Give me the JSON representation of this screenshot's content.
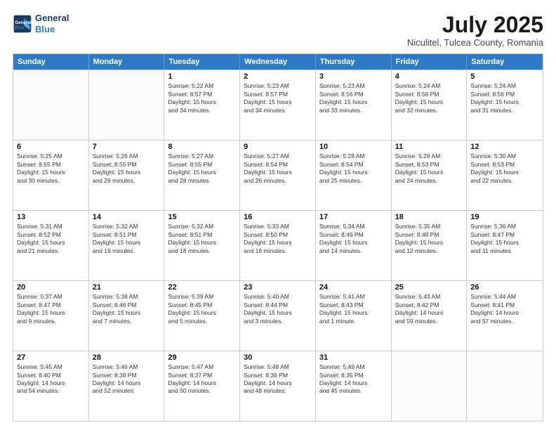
{
  "logo": {
    "line1": "General",
    "line2": "Blue"
  },
  "title": "July 2025",
  "subtitle": "Niculitel, Tulcea County, Romania",
  "header_days": [
    "Sunday",
    "Monday",
    "Tuesday",
    "Wednesday",
    "Thursday",
    "Friday",
    "Saturday"
  ],
  "weeks": [
    [
      {
        "day": "",
        "lines": []
      },
      {
        "day": "",
        "lines": []
      },
      {
        "day": "1",
        "lines": [
          "Sunrise: 5:22 AM",
          "Sunset: 8:57 PM",
          "Daylight: 15 hours",
          "and 34 minutes."
        ]
      },
      {
        "day": "2",
        "lines": [
          "Sunrise: 5:23 AM",
          "Sunset: 8:57 PM",
          "Daylight: 15 hours",
          "and 34 minutes."
        ]
      },
      {
        "day": "3",
        "lines": [
          "Sunrise: 5:23 AM",
          "Sunset: 8:56 PM",
          "Daylight: 15 hours",
          "and 33 minutes."
        ]
      },
      {
        "day": "4",
        "lines": [
          "Sunrise: 5:24 AM",
          "Sunset: 8:56 PM",
          "Daylight: 15 hours",
          "and 32 minutes."
        ]
      },
      {
        "day": "5",
        "lines": [
          "Sunrise: 5:24 AM",
          "Sunset: 8:56 PM",
          "Daylight: 15 hours",
          "and 31 minutes."
        ]
      }
    ],
    [
      {
        "day": "6",
        "lines": [
          "Sunrise: 5:25 AM",
          "Sunset: 8:55 PM",
          "Daylight: 15 hours",
          "and 30 minutes."
        ]
      },
      {
        "day": "7",
        "lines": [
          "Sunrise: 5:26 AM",
          "Sunset: 8:55 PM",
          "Daylight: 15 hours",
          "and 29 minutes."
        ]
      },
      {
        "day": "8",
        "lines": [
          "Sunrise: 5:27 AM",
          "Sunset: 8:55 PM",
          "Daylight: 15 hours",
          "and 28 minutes."
        ]
      },
      {
        "day": "9",
        "lines": [
          "Sunrise: 5:27 AM",
          "Sunset: 8:54 PM",
          "Daylight: 15 hours",
          "and 26 minutes."
        ]
      },
      {
        "day": "10",
        "lines": [
          "Sunrise: 5:28 AM",
          "Sunset: 8:54 PM",
          "Daylight: 15 hours",
          "and 25 minutes."
        ]
      },
      {
        "day": "11",
        "lines": [
          "Sunrise: 5:29 AM",
          "Sunset: 8:53 PM",
          "Daylight: 15 hours",
          "and 24 minutes."
        ]
      },
      {
        "day": "12",
        "lines": [
          "Sunrise: 5:30 AM",
          "Sunset: 8:53 PM",
          "Daylight: 15 hours",
          "and 22 minutes."
        ]
      }
    ],
    [
      {
        "day": "13",
        "lines": [
          "Sunrise: 5:31 AM",
          "Sunset: 8:52 PM",
          "Daylight: 15 hours",
          "and 21 minutes."
        ]
      },
      {
        "day": "14",
        "lines": [
          "Sunrise: 5:32 AM",
          "Sunset: 8:51 PM",
          "Daylight: 15 hours",
          "and 19 minutes."
        ]
      },
      {
        "day": "15",
        "lines": [
          "Sunrise: 5:32 AM",
          "Sunset: 8:51 PM",
          "Daylight: 15 hours",
          "and 18 minutes."
        ]
      },
      {
        "day": "16",
        "lines": [
          "Sunrise: 5:33 AM",
          "Sunset: 8:50 PM",
          "Daylight: 15 hours",
          "and 16 minutes."
        ]
      },
      {
        "day": "17",
        "lines": [
          "Sunrise: 5:34 AM",
          "Sunset: 8:49 PM",
          "Daylight: 15 hours",
          "and 14 minutes."
        ]
      },
      {
        "day": "18",
        "lines": [
          "Sunrise: 5:35 AM",
          "Sunset: 8:48 PM",
          "Daylight: 15 hours",
          "and 12 minutes."
        ]
      },
      {
        "day": "19",
        "lines": [
          "Sunrise: 5:36 AM",
          "Sunset: 8:47 PM",
          "Daylight: 15 hours",
          "and 11 minutes."
        ]
      }
    ],
    [
      {
        "day": "20",
        "lines": [
          "Sunrise: 5:37 AM",
          "Sunset: 8:47 PM",
          "Daylight: 15 hours",
          "and 9 minutes."
        ]
      },
      {
        "day": "21",
        "lines": [
          "Sunrise: 5:38 AM",
          "Sunset: 8:46 PM",
          "Daylight: 15 hours",
          "and 7 minutes."
        ]
      },
      {
        "day": "22",
        "lines": [
          "Sunrise: 5:39 AM",
          "Sunset: 8:45 PM",
          "Daylight: 15 hours",
          "and 5 minutes."
        ]
      },
      {
        "day": "23",
        "lines": [
          "Sunrise: 5:40 AM",
          "Sunset: 8:44 PM",
          "Daylight: 15 hours",
          "and 3 minutes."
        ]
      },
      {
        "day": "24",
        "lines": [
          "Sunrise: 5:41 AM",
          "Sunset: 8:43 PM",
          "Daylight: 15 hours",
          "and 1 minute."
        ]
      },
      {
        "day": "25",
        "lines": [
          "Sunrise: 5:43 AM",
          "Sunset: 8:42 PM",
          "Daylight: 14 hours",
          "and 59 minutes."
        ]
      },
      {
        "day": "26",
        "lines": [
          "Sunrise: 5:44 AM",
          "Sunset: 8:41 PM",
          "Daylight: 14 hours",
          "and 57 minutes."
        ]
      }
    ],
    [
      {
        "day": "27",
        "lines": [
          "Sunrise: 5:45 AM",
          "Sunset: 8:40 PM",
          "Daylight: 14 hours",
          "and 54 minutes."
        ]
      },
      {
        "day": "28",
        "lines": [
          "Sunrise: 5:46 AM",
          "Sunset: 8:38 PM",
          "Daylight: 14 hours",
          "and 52 minutes."
        ]
      },
      {
        "day": "29",
        "lines": [
          "Sunrise: 5:47 AM",
          "Sunset: 8:37 PM",
          "Daylight: 14 hours",
          "and 50 minutes."
        ]
      },
      {
        "day": "30",
        "lines": [
          "Sunrise: 5:48 AM",
          "Sunset: 8:36 PM",
          "Daylight: 14 hours",
          "and 48 minutes."
        ]
      },
      {
        "day": "31",
        "lines": [
          "Sunrise: 5:49 AM",
          "Sunset: 8:35 PM",
          "Daylight: 14 hours",
          "and 45 minutes."
        ]
      },
      {
        "day": "",
        "lines": []
      },
      {
        "day": "",
        "lines": []
      }
    ]
  ]
}
